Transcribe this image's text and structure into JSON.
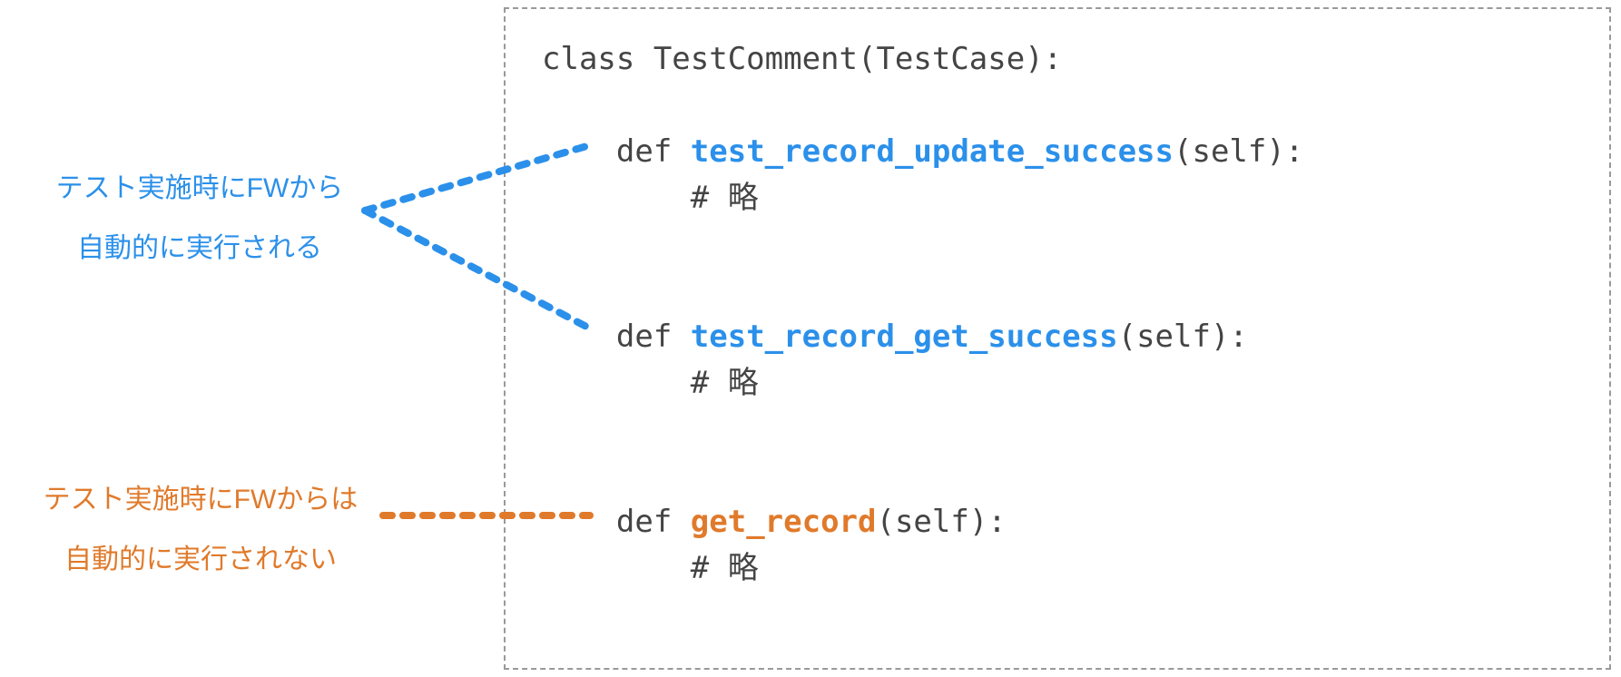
{
  "annotations": {
    "blue_line1": "テスト実施時にFWから",
    "blue_line2": "自動的に実行される",
    "orange_line1": "テスト実施時にFWからは",
    "orange_line2": "自動的に実行されない"
  },
  "code": {
    "class_decl": "class TestComment(TestCase):",
    "def_kw": "def ",
    "fn1": "test_record_update_success",
    "fn1_tail": "(self):",
    "fn2": "test_record_get_success",
    "fn2_tail": "(self):",
    "fn3": "get_record",
    "fn3_tail": "(self):",
    "body_comment": "# 略"
  },
  "colors": {
    "blue": "#2b90ea",
    "orange": "#e07a2b",
    "code_text": "#444"
  }
}
